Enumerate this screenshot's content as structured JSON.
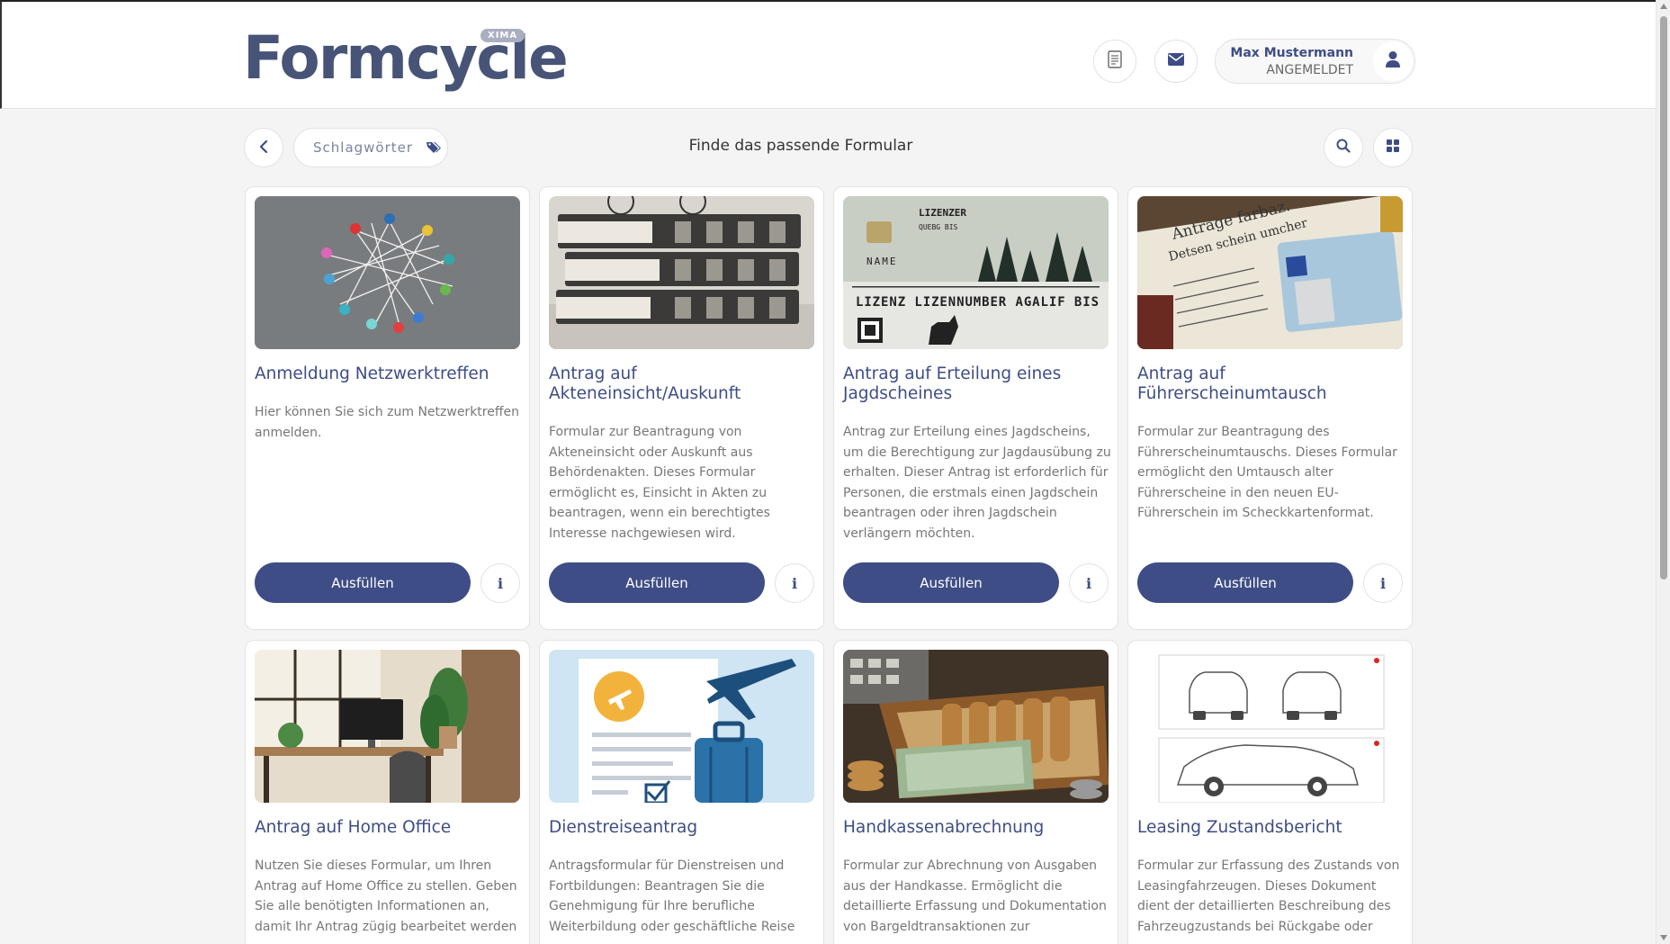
{
  "header": {
    "logo_text": "Formcycle",
    "logo_badge": "XIMA",
    "user_name": "Max Mustermann",
    "user_status": "ANGEMELDET"
  },
  "toolbar": {
    "tags_label": "Schlagwörter",
    "title": "Finde das passende Formular"
  },
  "cards": [
    {
      "title": "Anmeldung Netzwerktreffen",
      "description": "Hier können Sie sich zum Netzwerktreffen anmelden.",
      "button": "Ausfüllen",
      "info": "i"
    },
    {
      "title": "Antrag auf Akteneinsicht/Auskunft",
      "description": "Formular zur Beantragung von Akteneinsicht oder Auskunft aus Behördenakten. Dieses Formular ermöglicht es, Einsicht in Akten zu beantragen, wenn ein berechtigtes Interesse nachgewiesen wird.",
      "button": "Ausfüllen",
      "info": "i"
    },
    {
      "title": "Antrag auf Erteilung eines Jagdscheines",
      "description": "Antrag zur Erteilung eines Jagdscheins, um die Berechtigung zur Jagdausübung zu erhalten. Dieser Antrag ist erforderlich für Personen, die erstmals einen Jagdschein beantragen oder ihren Jagdschein verlängern möchten.",
      "button": "Ausfüllen",
      "info": "i",
      "image_text": [
        "LIZENZER",
        "QUEBG BIS",
        "NAME",
        "LIZENZ LIZENNUMBER AGALIF BIS"
      ]
    },
    {
      "title": "Antrag auf Führerscheinumtausch",
      "description": "Formular zur Beantragung des Führerscheinumtauschs. Dieses Formular ermöglicht den Umtausch alter Führerscheine in den neuen EU-Führerschein im Scheckkartenformat.",
      "button": "Ausfüllen",
      "info": "i",
      "image_text": [
        "Antrage farbaz.",
        "Detsen schein umcher"
      ]
    },
    {
      "title": "Antrag auf Home Office",
      "description": "Nutzen Sie dieses Formular, um Ihren Antrag auf Home Office zu stellen. Geben Sie alle benötigten Informationen an, damit Ihr Antrag zügig bearbeitet werden"
    },
    {
      "title": "Dienstreiseantrag",
      "description": "Antragsformular für Dienstreisen und Fortbildungen: Beantragen Sie die Genehmigung für Ihre berufliche Weiterbildung oder geschäftliche Reise"
    },
    {
      "title": "Handkassenabrechnung",
      "description": "Formular zur Abrechnung von Ausgaben aus der Handkasse. Ermöglicht die detaillierte Erfassung und Dokumentation von Bargeldtransaktionen zur"
    },
    {
      "title": "Leasing Zustandsbericht",
      "description": "Formular zur Erfassung des Zustands von Leasingfahrzeugen. Dieses Dokument dient der detaillierten Beschreibung des Fahrzeugzustands bei Rückgabe oder"
    }
  ],
  "colors": {
    "brand": "#3e4d86",
    "logo": "#475477",
    "background": "#f4f4f4"
  },
  "icons": [
    "document-icon",
    "mail-icon",
    "user-icon",
    "chevron-left-icon",
    "tags-icon",
    "search-icon",
    "grid-icon"
  ]
}
